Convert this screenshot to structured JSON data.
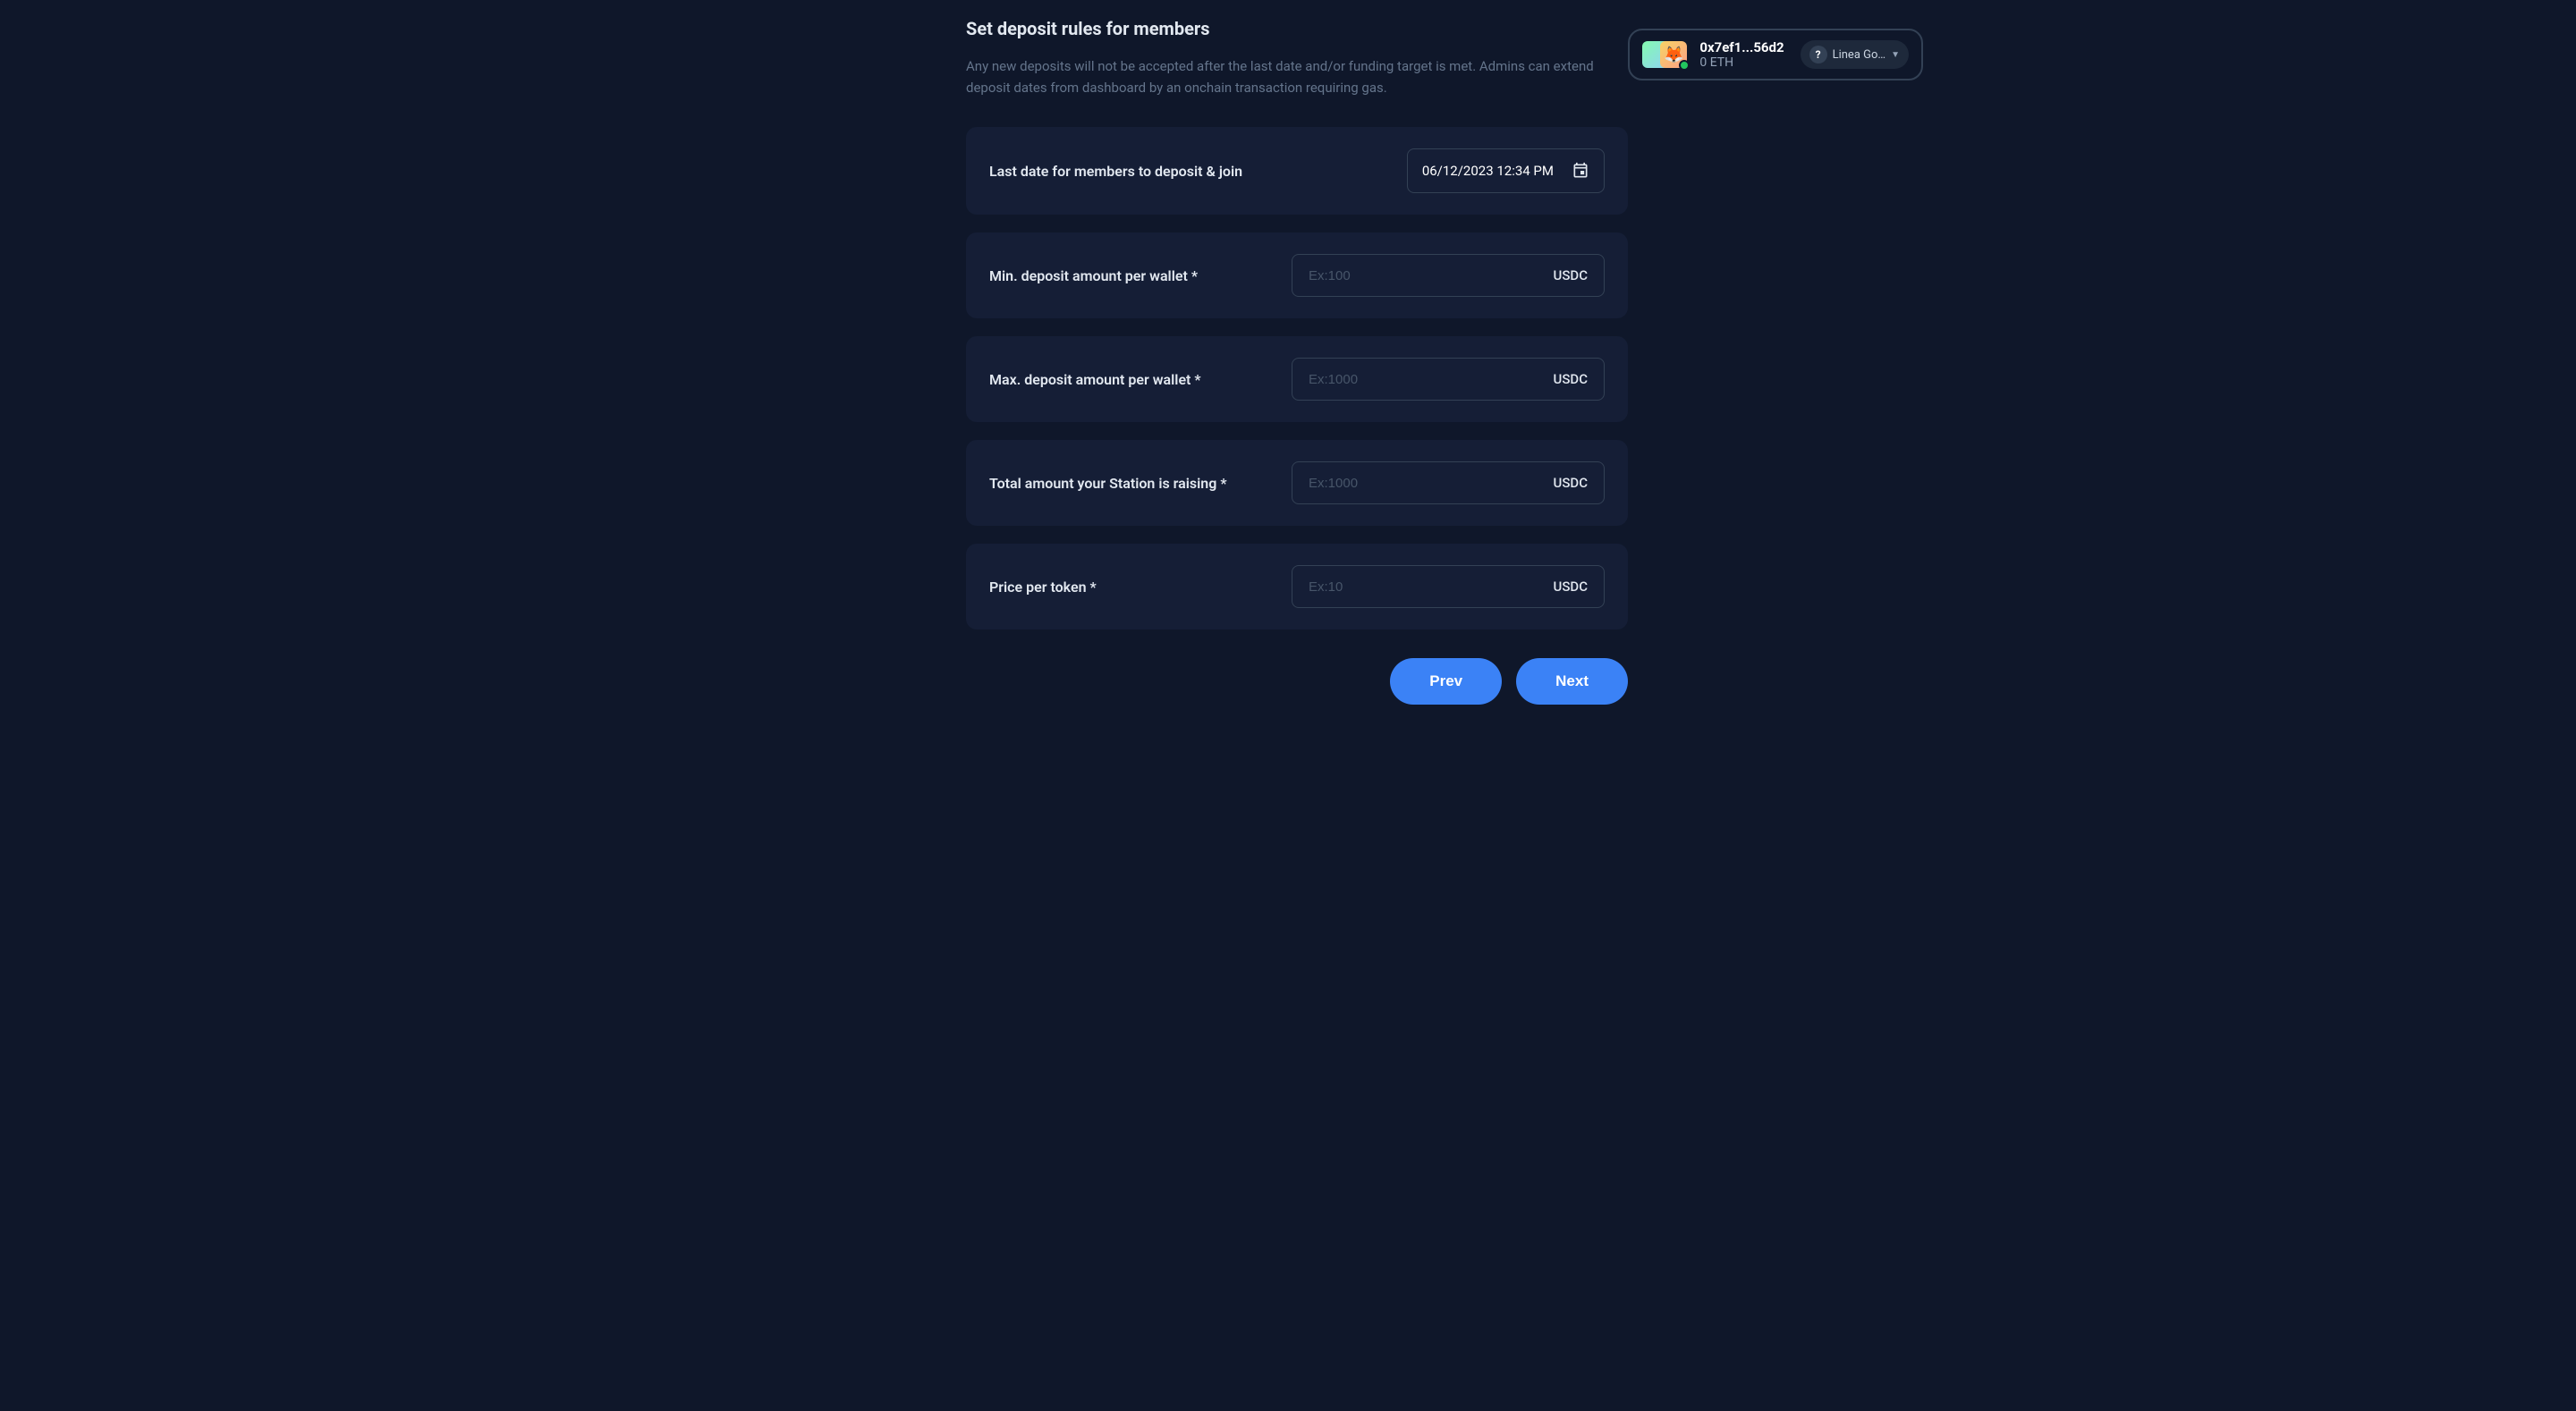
{
  "wallet": {
    "address": "0x7ef1...56d2",
    "balance": "0 ETH",
    "network": "Linea Go…",
    "avatar_emoji": "🦊"
  },
  "header": {
    "title": "Set deposit rules for members",
    "description": "Any new deposits will not be accepted after the last date and/or funding target is met. Admins can extend deposit dates from dashboard by an onchain transaction requiring gas."
  },
  "form": {
    "last_date": {
      "label": "Last date for members to deposit & join",
      "value": "06/12/2023 12:34 PM"
    },
    "min_deposit": {
      "label": "Min. deposit amount per wallet *",
      "placeholder": "Ex:100",
      "currency": "USDC"
    },
    "max_deposit": {
      "label": "Max. deposit amount per wallet *",
      "placeholder": "Ex:1000",
      "currency": "USDC"
    },
    "total_amount": {
      "label": "Total amount your Station is raising *",
      "placeholder": "Ex:1000",
      "currency": "USDC"
    },
    "price_per_token": {
      "label": "Price per token *",
      "placeholder": "Ex:10",
      "currency": "USDC"
    }
  },
  "buttons": {
    "prev": "Prev",
    "next": "Next"
  }
}
